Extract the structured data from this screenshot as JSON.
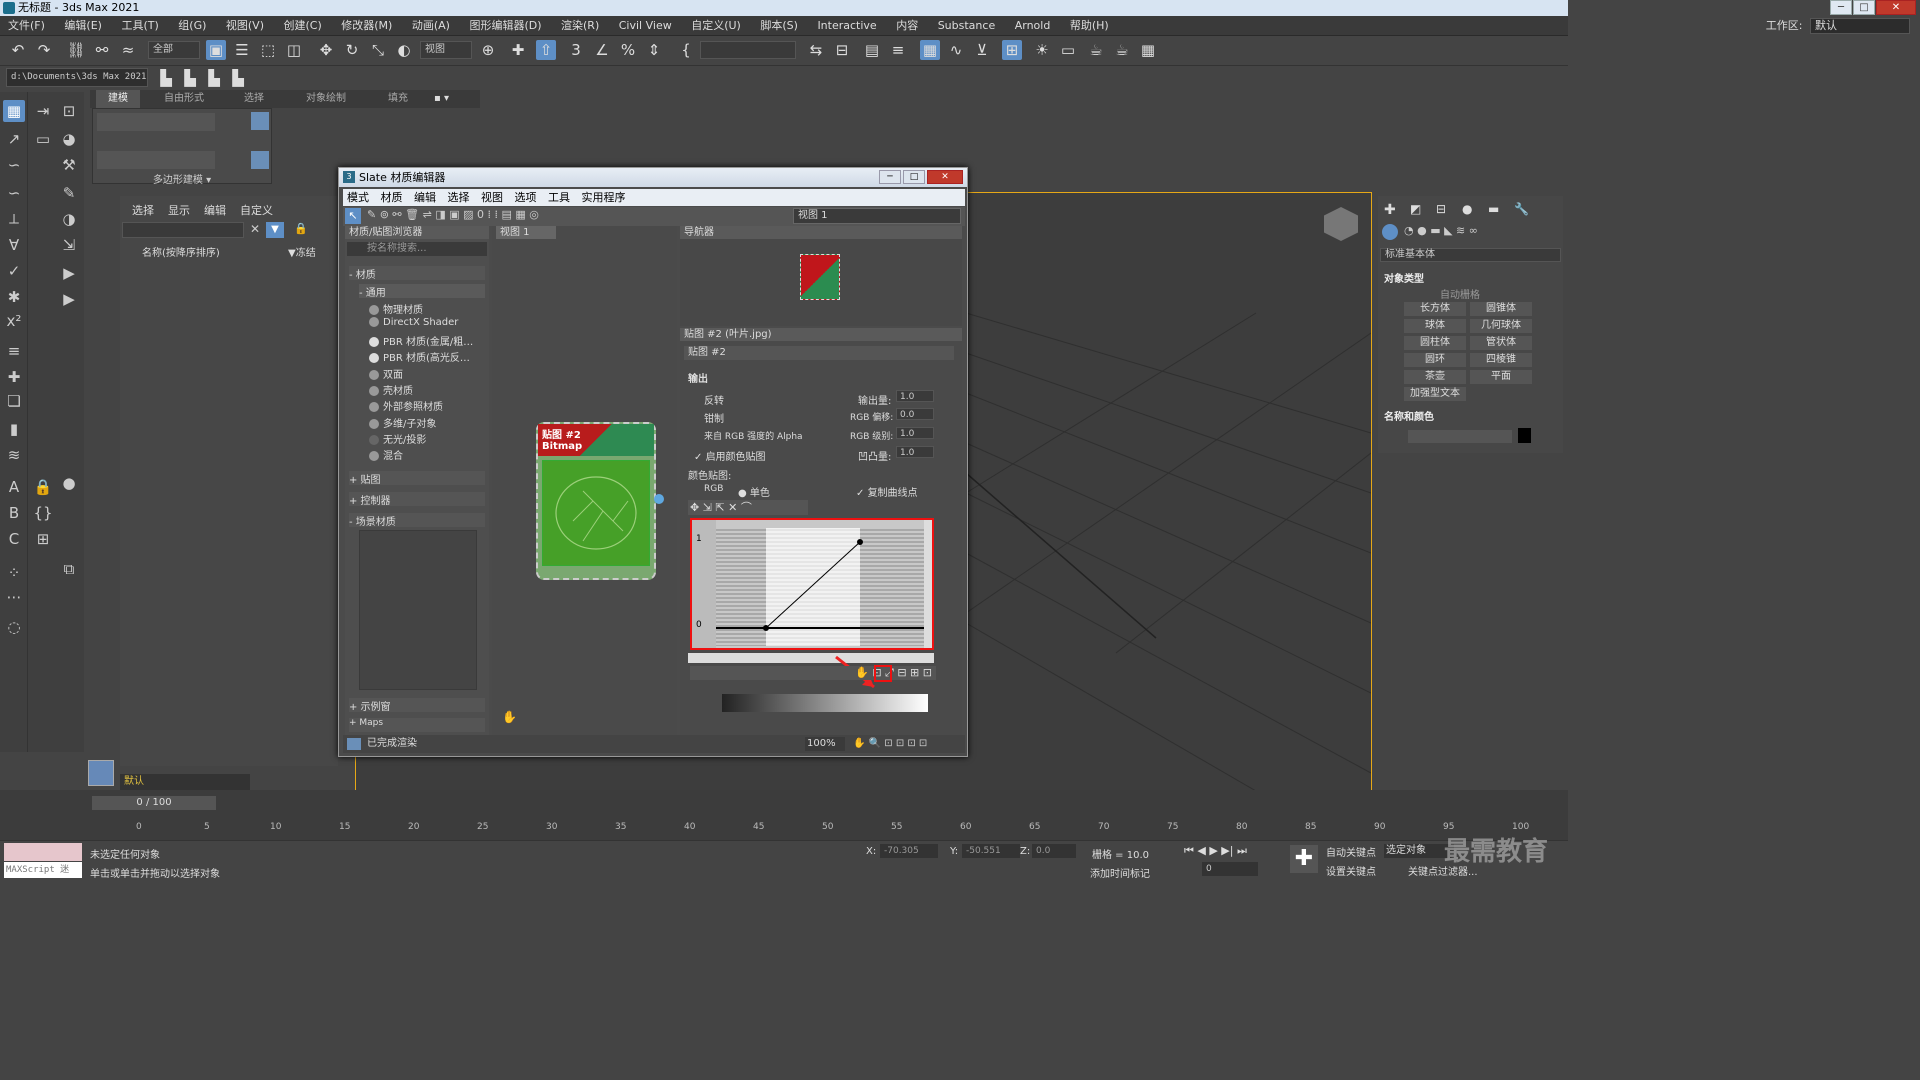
{
  "app": {
    "title": "无标题 - 3ds Max 2021",
    "window_buttons": [
      "─",
      "□",
      "✕"
    ]
  },
  "menu": [
    "文件(F)",
    "编辑(E)",
    "工具(T)",
    "组(G)",
    "视图(V)",
    "创建(C)",
    "修改器(M)",
    "动画(A)",
    "图形编辑器(D)",
    "渲染(R)",
    "Civil View",
    "自定义(U)",
    "脚本(S)",
    "Interactive",
    "内容",
    "Substance",
    "Arnold",
    "帮助(H)"
  ],
  "workspace": {
    "label": "工作区:",
    "value": "默认"
  },
  "toolbar": {
    "selection_filter": "全部",
    "ref_coord": "视图"
  },
  "project_path": "d:\\Documents\\3ds Max 2021",
  "ribbon": {
    "tabs": [
      "建模",
      "自由形式",
      "选择",
      "对象绘制",
      "填充"
    ],
    "group": "多边形建模 ▾"
  },
  "scene_explorer": {
    "menu": [
      "选择",
      "显示",
      "编辑",
      "自定义"
    ],
    "column_name": "名称(按降序排序)",
    "column_frozen": "▼冻结"
  },
  "slate": {
    "title": "Slate 材质编辑器",
    "menu": [
      "模式",
      "材质",
      "编辑",
      "选择",
      "视图",
      "选项",
      "工具",
      "实用程序"
    ],
    "view_select": "视图 1",
    "browser": {
      "header": "材质/贴图浏览器",
      "search": "按名称搜索...",
      "materials_group": "- 材质",
      "general_group": "- 通用",
      "materials": [
        "物理材质",
        "DirectX Shader",
        "PBR 材质(金属/粗…",
        "PBR 材质(高光反…",
        "双面",
        "壳材质",
        "外部参照材质",
        "多维/子对象",
        "无光/投影",
        "混合"
      ],
      "collapsed": [
        "+ 贴图",
        "+ 控制器",
        "- 场景材质"
      ],
      "bottom": [
        "+ 示例窗",
        "+ Maps"
      ]
    },
    "view_tab": "视图 1",
    "node": {
      "title": "贴图 #2",
      "subtitle": "Bitmap"
    },
    "navigator_header": "导航器",
    "props_header": "贴图 #2 (叶片.jpg)",
    "map_name": "贴图 #2",
    "output": {
      "rollout": "输出",
      "invert": "反转",
      "clamp": "钳制",
      "alpha_from_rgb": "来自 RGB 强度的 Alpha",
      "enable_color_map": "启用颜色贴图",
      "output_amount_label": "输出量:",
      "output_amount": "1.0",
      "rgb_offset_label": "RGB 偏移:",
      "rgb_offset": "0.0",
      "rgb_level_label": "RGB 级别:",
      "rgb_level": "1.0",
      "bump_amount_label": "凹凸量:",
      "bump_amount": "1.0",
      "color_map_label": "颜色贴图:",
      "rgb_option": "RGB",
      "mono_option": "单色",
      "copy_curve": "复制曲线点",
      "curve_y_top": "1",
      "curve_y_bottom": "0"
    },
    "status": "已完成渲染",
    "zoom": "100%"
  },
  "right_panel": {
    "category": "标准基本体",
    "object_type_header": "对象类型",
    "autogrid": "自动栅格",
    "buttons": [
      "长方体",
      "圆锥体",
      "球体",
      "几何球体",
      "圆柱体",
      "管状体",
      "圆环",
      "四棱锥",
      "茶壶",
      "平面",
      "加强型文本"
    ],
    "name_color_header": "名称和颜色"
  },
  "bottom": {
    "layer": "默认",
    "frame_counter": "0 / 100",
    "ticks": [
      "0",
      "5",
      "10",
      "15",
      "20",
      "25",
      "30",
      "35",
      "40",
      "45",
      "50",
      "55",
      "60",
      "65",
      "70",
      "75",
      "80",
      "85",
      "90",
      "95",
      "100"
    ],
    "status_line1": "未选定任何对象",
    "status_line2": "单击或单击并拖动以选择对象",
    "maxscript": "MAXScript 迷",
    "x_label": "X:",
    "x_value": "-70.305",
    "y_label": "Y:",
    "y_value": "-50.551",
    "z_label": "Z:",
    "z_value": "0.0",
    "grid": "栅格 = 10.0",
    "add_time_tag": "添加时间标记",
    "auto_key": "自动关键点",
    "selected_obj": "选定对象",
    "set_key": "设置关键点",
    "key_filter": "关键点过滤器...",
    "frame": "0",
    "watermark": "最需教育"
  }
}
